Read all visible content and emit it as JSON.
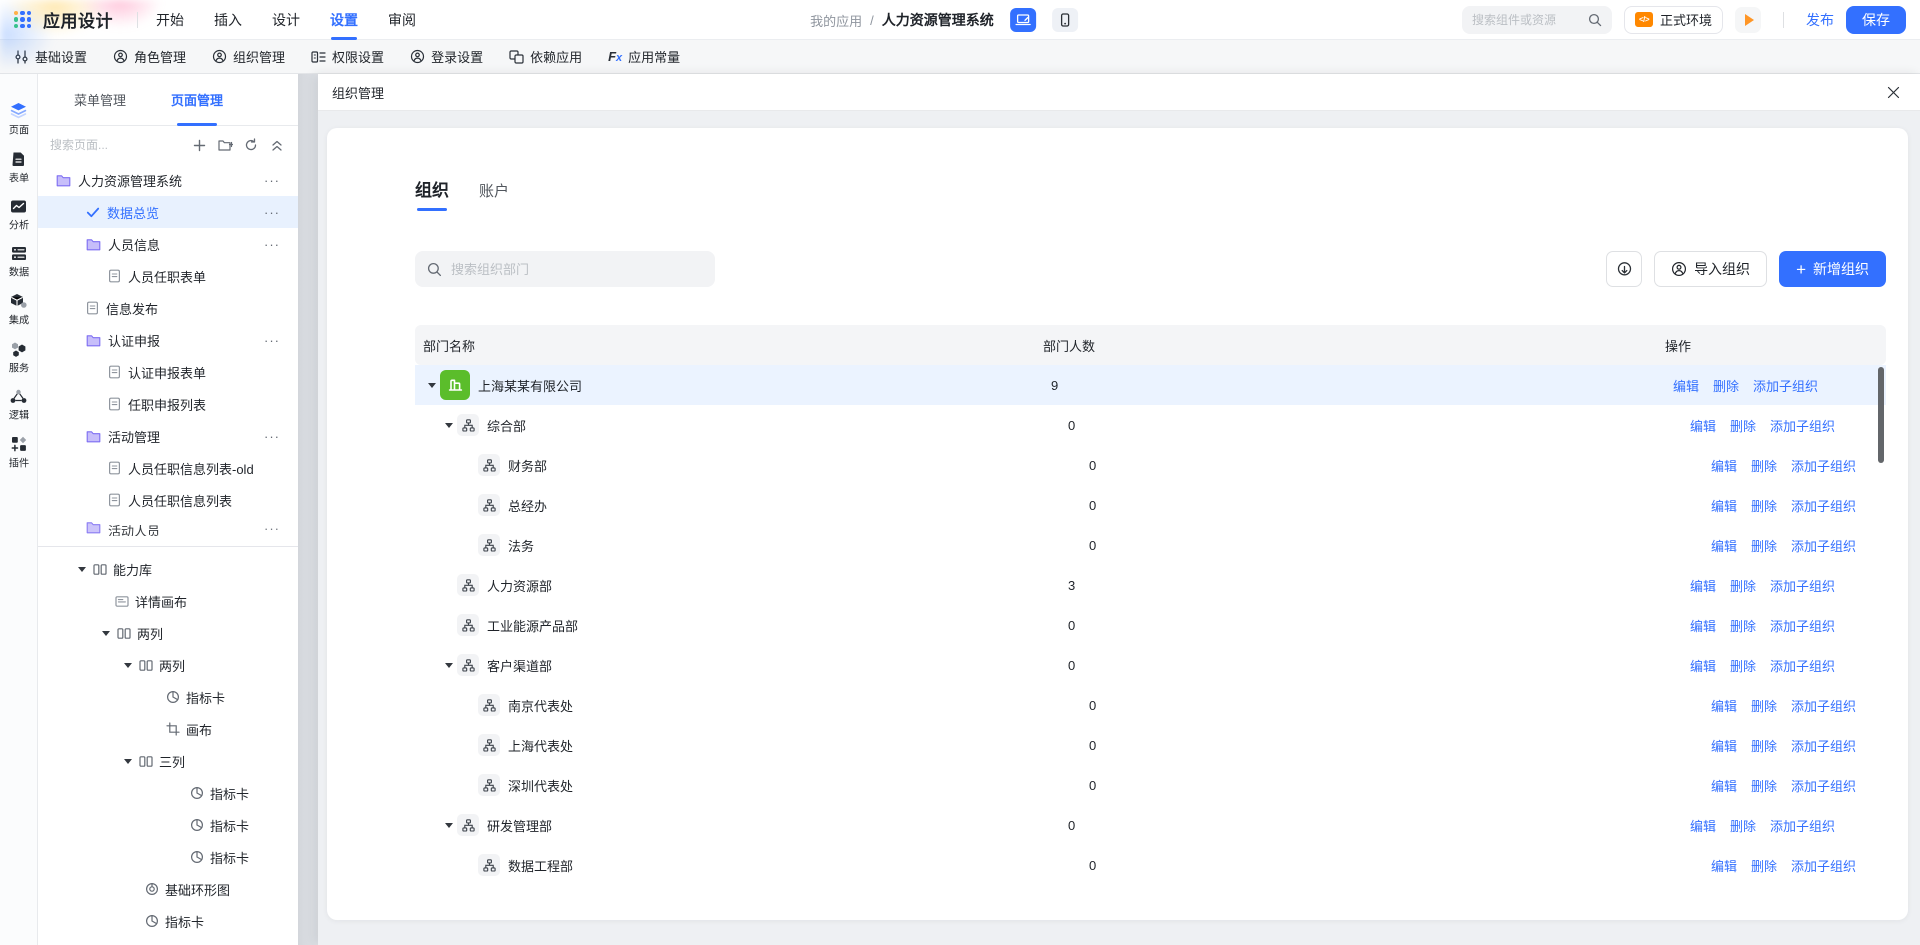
{
  "topbar": {
    "app_title": "应用设计",
    "menus": [
      {
        "label": "开始"
      },
      {
        "label": "插入"
      },
      {
        "label": "设计"
      },
      {
        "label": "设置",
        "active": true
      },
      {
        "label": "审阅"
      }
    ],
    "breadcrumb": {
      "parent": "我的应用",
      "separator": "/",
      "current": "人力资源管理系统"
    },
    "search_placeholder": "搜索组件或资源",
    "env_badge": {
      "label": "正式环境",
      "icon": "code-icon",
      "icon_color": "#ff8800"
    },
    "publish_label": "发布",
    "save_label": "保存",
    "accent_color": "#3370ff"
  },
  "ribbon": {
    "items": [
      {
        "label": "基础设置",
        "icon": "tune-icon",
        "divider_after": true
      },
      {
        "label": "角色管理",
        "icon": "user-icon"
      },
      {
        "label": "组织管理",
        "icon": "user-icon"
      },
      {
        "label": "权限设置",
        "icon": "permission-icon"
      },
      {
        "label": "登录设置",
        "icon": "user-icon"
      },
      {
        "label": "依赖应用",
        "icon": "apps-icon"
      },
      {
        "label": "应用常量",
        "icon": "fx-icon"
      }
    ]
  },
  "rail": {
    "items": [
      {
        "label": "页面",
        "icon": "pages-icon",
        "active": true
      },
      {
        "label": "表单",
        "icon": "form-icon"
      },
      {
        "label": "分析",
        "icon": "analysis-icon"
      },
      {
        "label": "数据",
        "icon": "data-icon"
      },
      {
        "label": "集成",
        "icon": "integration-icon"
      },
      {
        "label": "服务",
        "icon": "service-icon"
      },
      {
        "label": "逻辑",
        "icon": "logic-icon"
      },
      {
        "label": "插件",
        "icon": "plugin-icon"
      }
    ]
  },
  "sidebar": {
    "tabs": [
      {
        "label": "菜单管理"
      },
      {
        "label": "页面管理",
        "active": true
      }
    ],
    "search_placeholder": "搜索页面...",
    "tools": [
      "plus-icon",
      "add-folder-icon",
      "refresh-icon",
      "collapse-icon"
    ],
    "tree": [
      {
        "label": "人力资源管理系统",
        "icon": "folder-icon",
        "level": 0,
        "more": true
      },
      {
        "label": "数据总览",
        "icon": "check-icon",
        "level": 1,
        "more": true,
        "active": true
      },
      {
        "label": "人员信息",
        "icon": "folder-icon",
        "level": 1,
        "more": true
      },
      {
        "label": "人员任职表单",
        "icon": "page-icon",
        "level": 2
      },
      {
        "label": "信息发布",
        "icon": "page-icon",
        "level": 1
      },
      {
        "label": "认证申报",
        "icon": "folder-icon",
        "level": 1,
        "more": true
      },
      {
        "label": "认证申报表单",
        "icon": "page-icon",
        "level": 2
      },
      {
        "label": "任职申报列表",
        "icon": "page-icon",
        "level": 2
      },
      {
        "label": "活动管理",
        "icon": "folder-icon",
        "level": 1,
        "more": true
      },
      {
        "label": "人员任职信息列表-old",
        "icon": "page-icon",
        "level": 2
      },
      {
        "label": "人员任职信息列表",
        "icon": "page-icon",
        "level": 2
      },
      {
        "label": "活动人员",
        "icon": "folder-icon",
        "level": 1,
        "more": true,
        "clipped": true
      }
    ],
    "outline": [
      {
        "label": "能力库",
        "icon": "columns-icon",
        "level": 0,
        "arrow": true
      },
      {
        "label": "详情画布",
        "icon": "canvas-icon",
        "level": 1
      },
      {
        "label": "两列",
        "icon": "columns-icon",
        "level": 1,
        "arrow": true
      },
      {
        "label": "两列",
        "icon": "columns-icon",
        "level": 2,
        "arrow": true
      },
      {
        "label": "指标卡",
        "icon": "gauge-icon",
        "level": 4
      },
      {
        "label": "画布",
        "icon": "frame-icon",
        "level": 4
      },
      {
        "label": "三列",
        "icon": "columns-icon",
        "level": 2,
        "arrow": true
      },
      {
        "label": "指标卡",
        "icon": "gauge-icon",
        "level": 5
      },
      {
        "label": "指标卡",
        "icon": "gauge-icon",
        "level": 5
      },
      {
        "label": "指标卡",
        "icon": "gauge-icon",
        "level": 5
      },
      {
        "label": "基础环形图",
        "icon": "donut-icon",
        "level": 3
      },
      {
        "label": "指标卡",
        "icon": "gauge-icon",
        "level": 3
      }
    ]
  },
  "drawer": {
    "title": "组织管理",
    "tabs": [
      {
        "label": "组织",
        "active": true
      },
      {
        "label": "账户"
      }
    ],
    "search_placeholder": "搜索组织部门",
    "import_label": "导入组织",
    "add_label": "新增组织",
    "table": {
      "columns": [
        "部门名称",
        "部门人数",
        "操作"
      ],
      "actions": [
        "编辑",
        "删除",
        "添加子组织"
      ],
      "rows": [
        {
          "name": "上海某某有限公司",
          "count": "9",
          "level": 0,
          "arrow": true,
          "icon": "company",
          "selected": true
        },
        {
          "name": "综合部",
          "count": "0",
          "level": 1,
          "arrow": true,
          "icon": "org"
        },
        {
          "name": "财务部",
          "count": "0",
          "level": 2,
          "icon": "org"
        },
        {
          "name": "总经办",
          "count": "0",
          "level": 2,
          "icon": "org"
        },
        {
          "name": "法务",
          "count": "0",
          "level": 2,
          "icon": "org"
        },
        {
          "name": "人力资源部",
          "count": "3",
          "level": 1,
          "icon": "org"
        },
        {
          "name": "工业能源产品部",
          "count": "0",
          "level": 1,
          "icon": "org"
        },
        {
          "name": "客户渠道部",
          "count": "0",
          "level": 1,
          "arrow": true,
          "icon": "org"
        },
        {
          "name": "南京代表处",
          "count": "0",
          "level": 2,
          "icon": "org"
        },
        {
          "name": "上海代表处",
          "count": "0",
          "level": 2,
          "icon": "org"
        },
        {
          "name": "深圳代表处",
          "count": "0",
          "level": 2,
          "icon": "org"
        },
        {
          "name": "研发管理部",
          "count": "0",
          "level": 1,
          "arrow": true,
          "icon": "org"
        },
        {
          "name": "数据工程部",
          "count": "0",
          "level": 2,
          "icon": "org"
        }
      ],
      "status_colors": {
        "company_icon_green": "#5bbd2b",
        "link_blue": "#3370ff"
      }
    }
  }
}
